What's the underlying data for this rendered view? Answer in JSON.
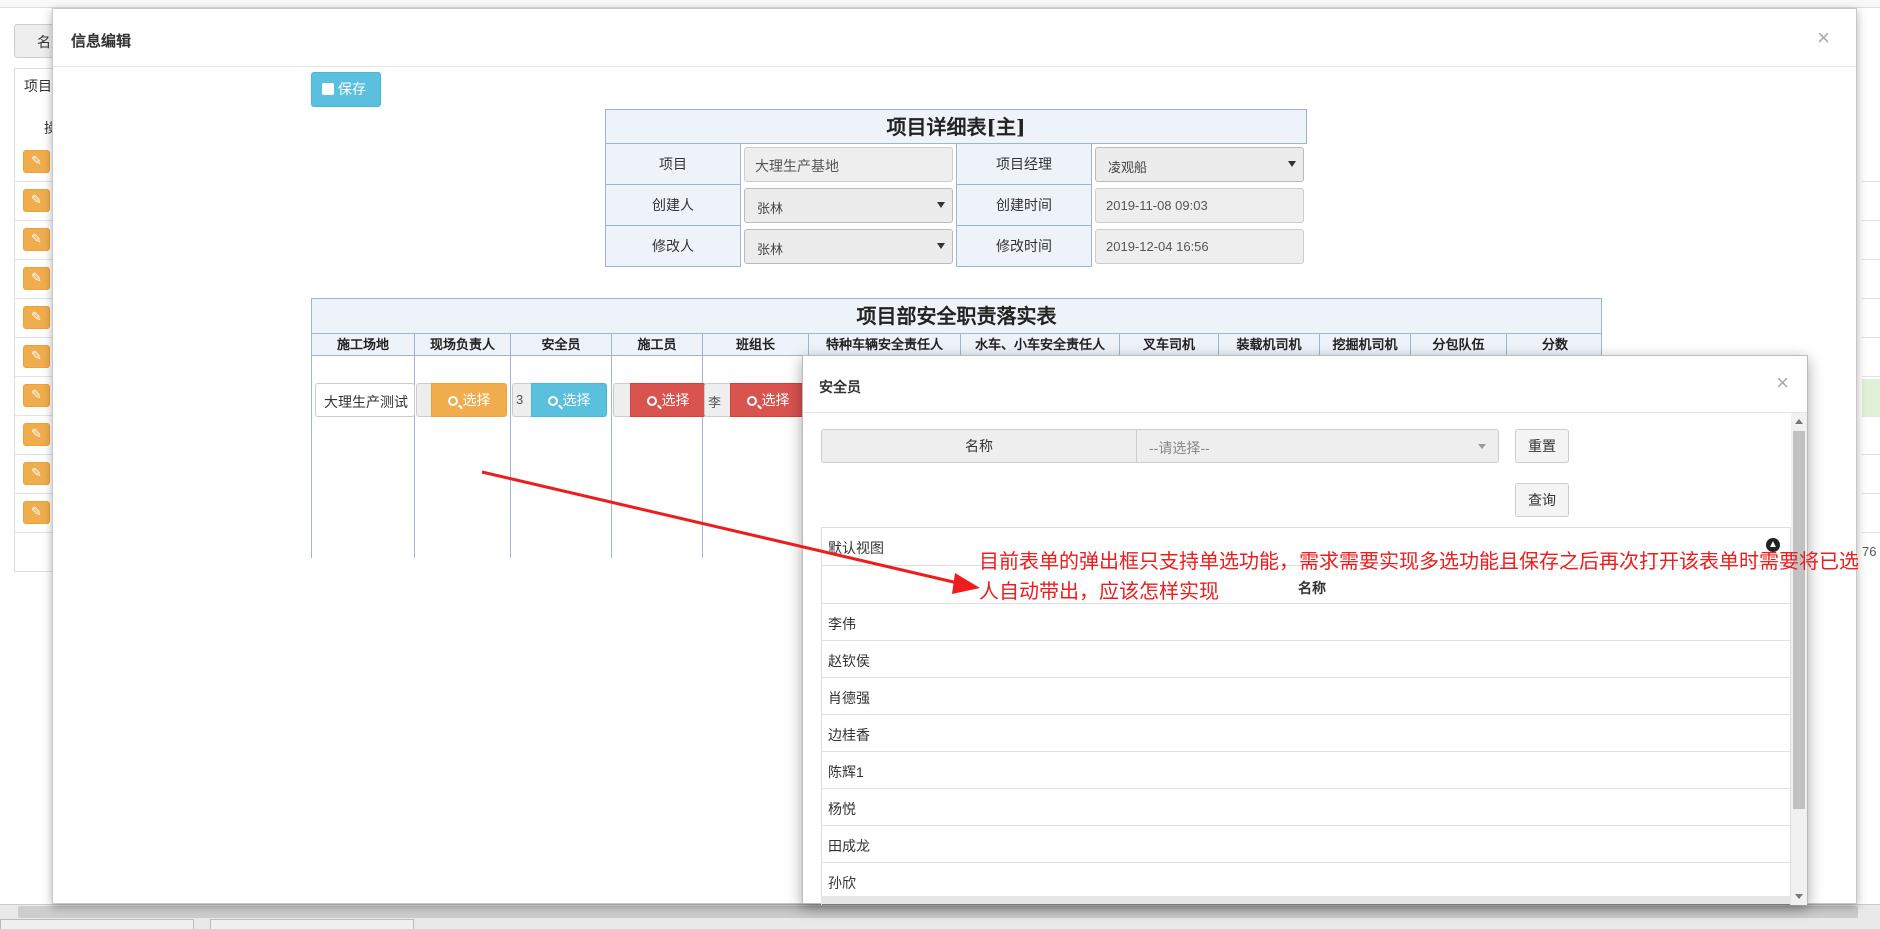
{
  "background": {
    "tab_label": "名",
    "header_label": "项目",
    "header_label2": "操",
    "page_fragment": "76"
  },
  "modal": {
    "title": "信息编辑",
    "close": "×",
    "save_label": "保存"
  },
  "detail": {
    "title": "项目详细表[主]",
    "rows": [
      {
        "label1": "项目",
        "value1": "大理生产基地",
        "label2": "项目经理",
        "value2": "凌观船"
      },
      {
        "label1": "创建人",
        "value1": "张林",
        "label2": "创建时间",
        "value2": "2019-11-08 09:03"
      },
      {
        "label1": "修改人",
        "value1": "张林",
        "label2": "修改时间",
        "value2": "2019-12-04 16:56"
      }
    ]
  },
  "responsibility": {
    "title": "项目部安全职责落实表",
    "headers": [
      "施工场地",
      "现场负责人",
      "安全员",
      "施工员",
      "班组长",
      "特种车辆安全责任人",
      "水车、小车安全责任人",
      "叉车司机",
      "装载机司机",
      "挖掘机司机",
      "分包队伍",
      "分数"
    ],
    "site_value": "大理生产测试",
    "stub_values": [
      "",
      "3",
      "",
      "李"
    ],
    "select_label": "选择"
  },
  "picker": {
    "title": "安全员",
    "close": "×",
    "filter_label": "名称",
    "filter_placeholder": "--请选择--",
    "reset_label": "重置",
    "query_label": "查询",
    "view_label": "默认视图",
    "collapse_icon": "up-arrow-circle-icon",
    "column_header": "名称",
    "rows": [
      "李伟",
      "赵钦侯",
      "肖德强",
      "边桂香",
      "陈辉1",
      "杨悦",
      "田成龙",
      "孙欣"
    ]
  },
  "annotation": {
    "text": "目前表单的弹出框只支持单选功能，需求需要实现多选功能且保存之后再次打开该表单时需要将已选人自动带出，应该怎样实现",
    "color": "#ee1c1c"
  },
  "colors": {
    "info": "#5bc0de",
    "warning": "#f0ad4e",
    "danger": "#d9534f",
    "table_bg": "#eef3fa",
    "table_border": "#9cb6d6"
  }
}
